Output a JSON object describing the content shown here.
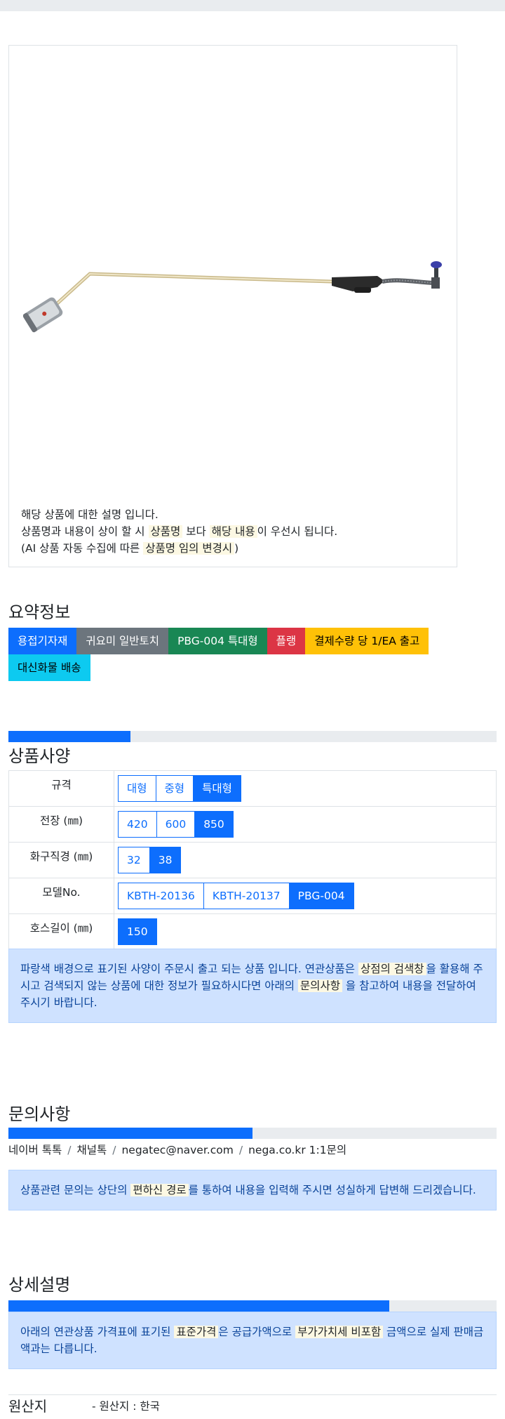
{
  "product": {
    "image_icon": "gas-torch-image",
    "desc_line1": "해당 상품에 대한 설명 입니다.",
    "desc_line2_pre": "상품명과 내용이 상이 할 시 ",
    "desc_line2_mark1": "상품명",
    "desc_line2_mid": " 보다 ",
    "desc_line2_mark2": "해당 내용",
    "desc_line2_post": "이 우선시 됩니다.",
    "desc_line3_pre": "(AI 상품 자동 수집에 따른 ",
    "desc_line3_mark": "상품명 임의 변경시",
    "desc_line3_post": ")"
  },
  "summary": {
    "title": "요약정보",
    "badges": [
      "용접기자재",
      "귀요미 일반토치",
      "PBG-004 특대형",
      "플랭",
      "결제수량 당 1/EA 출고",
      "대신화물 배송"
    ]
  },
  "spec": {
    "progress": 0.25,
    "title": "상품사양",
    "rows": [
      {
        "label": "규격",
        "options": [
          "대형",
          "중형",
          "특대형"
        ],
        "selected": 2
      },
      {
        "label": "전장 (㎜)",
        "options": [
          "420",
          "600",
          "850"
        ],
        "selected": 2
      },
      {
        "label": "화구직경 (㎜)",
        "options": [
          "32",
          "38"
        ],
        "selected": 1
      },
      {
        "label": "모델No.",
        "options": [
          "KBTH-20136",
          "KBTH-20137",
          "PBG-004"
        ],
        "selected": 2
      },
      {
        "label": "호스길이 (㎜)",
        "options": [
          "150"
        ],
        "selected": 0
      }
    ],
    "notice_pre": "파랑색 배경으로 표기된 사양이 주문시 출고 되는 상품 입니다. 연관상품은 ",
    "notice_mark1": "상점의 검색창",
    "notice_mid": "을 활용해 주시고 검색되지 않는 상품에 대한 정보가 필요하시다면 아래의 ",
    "notice_mark2": "문의사항",
    "notice_post": " 을 참고하여 내용을 전달하여 주시기 바랍니다."
  },
  "inquiry": {
    "title": "문의사항",
    "progress": 0.5,
    "contacts": [
      "네이버 톡톡",
      "채널톡",
      "negatec@naver.com",
      "nega.co.kr 1:1문의"
    ],
    "separator": "/",
    "notice_pre": "상품관련 문의는 상단의 ",
    "notice_mark": "편하신 경로",
    "notice_post": "를 통하여 내용을 입력해 주시면 성실하게 답변해 드리겠습니다."
  },
  "detail": {
    "title": "상세설명",
    "progress": 0.78,
    "notice_pre": "아래의 연관상품 가격표에 표기된 ",
    "notice_mark1": "표준가격",
    "notice_mid": "은 공급가액으로 ",
    "notice_mark2": "부가가치세 비포함",
    "notice_post": " 금액으로 실제 판매금액과는 다릅니다."
  },
  "origin": {
    "key": "원산지",
    "value": "- 원산지 : 한국"
  }
}
